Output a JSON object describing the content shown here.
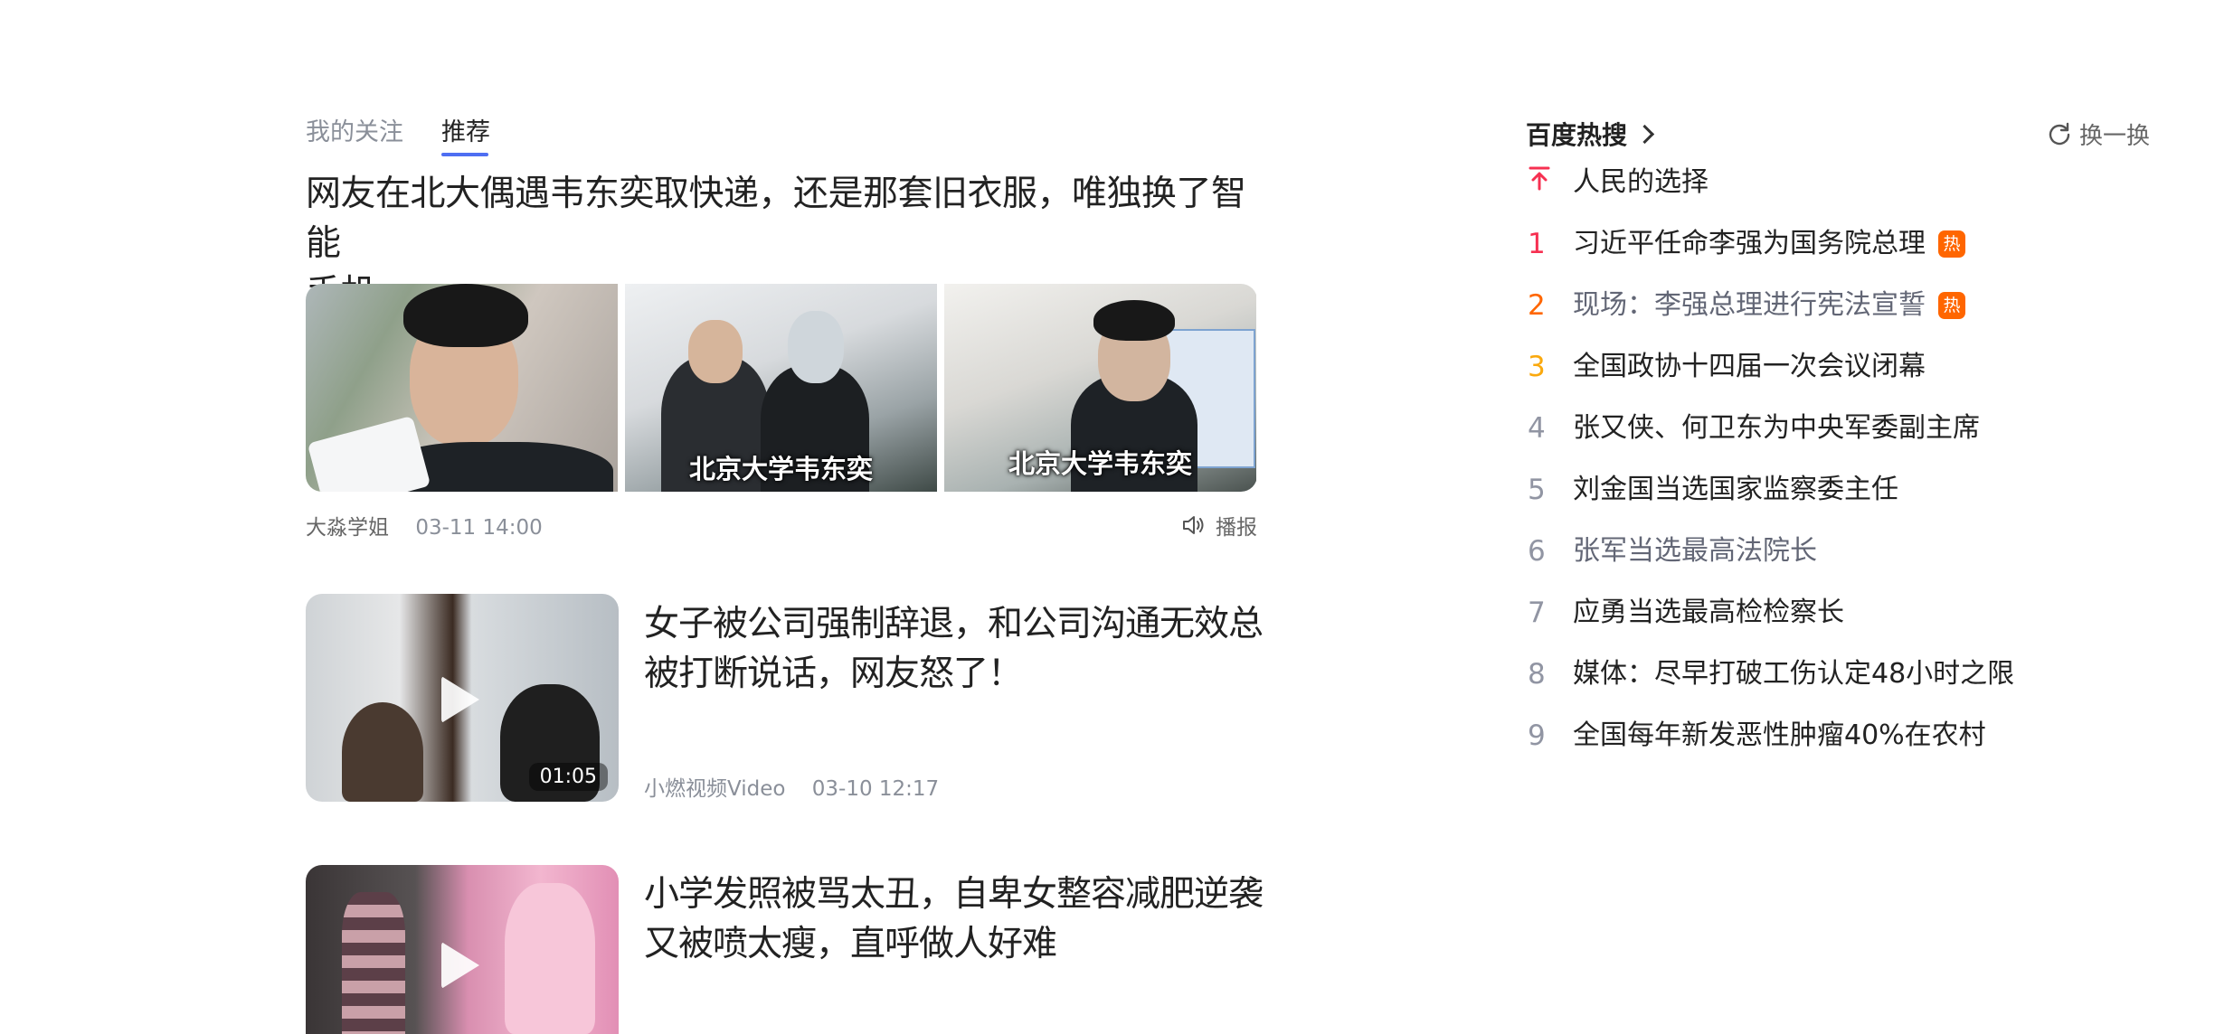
{
  "tabs": {
    "follow": "我的关注",
    "recommend": "推荐"
  },
  "article1": {
    "title_line1": "网友在北大偶遇韦东奕取快递，还是那套旧衣服，唯独换了智能",
    "title_line2": "手机",
    "image_captions": [
      "北京大学韦东奕",
      "北京大学韦东奕"
    ],
    "author": "大淼学姐",
    "time": "03-11 14:00",
    "broadcast_label": "播报"
  },
  "article2": {
    "title_line1": "女子被公司强制辞退，和公司沟通无效总",
    "title_line2": "被打断说话，网友怒了！",
    "duration": "01:05",
    "author": "小燃视频Video",
    "time": "03-10 12:17"
  },
  "article3": {
    "title_line1": "小学发照被骂太丑，自卑女整容减肥逆袭",
    "title_line2": "又被喷太瘦，直呼做人好难"
  },
  "hot_search": {
    "title": "百度热搜",
    "refresh_label": "换一换",
    "pinned": {
      "text": "人民的选择"
    },
    "items": [
      {
        "rank": "1",
        "text": "习近平任命李强为国务院总理",
        "badge": "热"
      },
      {
        "rank": "2",
        "text": "现场：李强总理进行宪法宣誓",
        "badge": "热"
      },
      {
        "rank": "3",
        "text": "全国政协十四届一次会议闭幕"
      },
      {
        "rank": "4",
        "text": "张又侠、何卫东为中央军委副主席"
      },
      {
        "rank": "5",
        "text": "刘金国当选国家监察委主任"
      },
      {
        "rank": "6",
        "text": "张军当选最高法院长"
      },
      {
        "rank": "7",
        "text": "应勇当选最高检检察长"
      },
      {
        "rank": "8",
        "text": "媒体：尽早打破工伤认定48小时之限"
      },
      {
        "rank": "9",
        "text": "全国每年新发恶性肿瘤40%在农村"
      }
    ]
  },
  "colors": {
    "accent": "#4e6ef2",
    "rank1": "#f63051",
    "rank2": "#ff6600",
    "rank3": "#faa90e",
    "hot_badge": "#ff6600"
  }
}
